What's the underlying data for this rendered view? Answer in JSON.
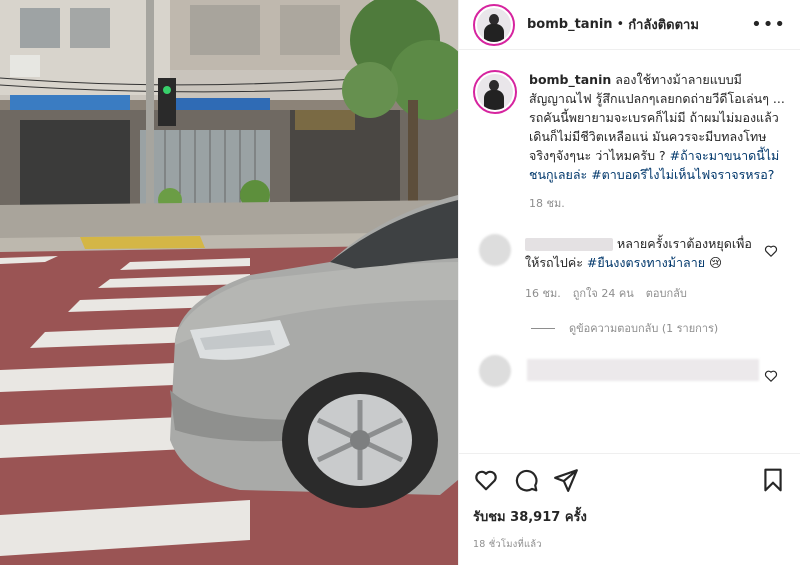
{
  "header": {
    "username": "bomb_tanin",
    "separator": "•",
    "follow_status": "กำลังติดตาม",
    "more_label": "•••"
  },
  "caption": {
    "username": "bomb_tanin",
    "text": "ลองใช้ทางม้าลายแบบมีสัญญาณไฟ รู้สึกแปลกๆเลยกดถ่ายวีดีโอเล่นๆ ... รถคันนี้พยายามจะเบรคก็ไม่มี ถ้าผมไม่มองแล้วเดินก็ไม่มีชีวิตเหลือแน่ มันควรจะมีบทลงโทษจริงๆจังๆนะ ว่าไหมครับ ?",
    "hashtags": "#ถ้าจะมาขนาดนี้ไม่ชนกูเลยล่ะ #ตาบอดรึไงไม่เห็นไฟจราจรหรอ?",
    "time": "18 ชม."
  },
  "comment": {
    "text": "หลายครั้งเราต้องหยุดเพื่อให้รถไปค่ะ",
    "hashtag": "#ยืนงงตรงทางม้าลาย",
    "emoji": "😢",
    "time": "16 ชม.",
    "likes": "ถูกใจ 24 คน",
    "reply": "ตอบกลับ",
    "view_replies": "ดูข้อความตอบกลับ (1 รายการ)"
  },
  "footer": {
    "views": "รับชม 38,917 ครั้ง",
    "posted": "18 ชั่วโมงที่แล้ว"
  },
  "icons": [
    "heart-icon",
    "comment-icon",
    "share-icon",
    "bookmark-icon",
    "more-icon"
  ],
  "colors": {
    "hashtag": "#00376b",
    "meta": "#8e8e8e",
    "ring": "#d6249f"
  }
}
